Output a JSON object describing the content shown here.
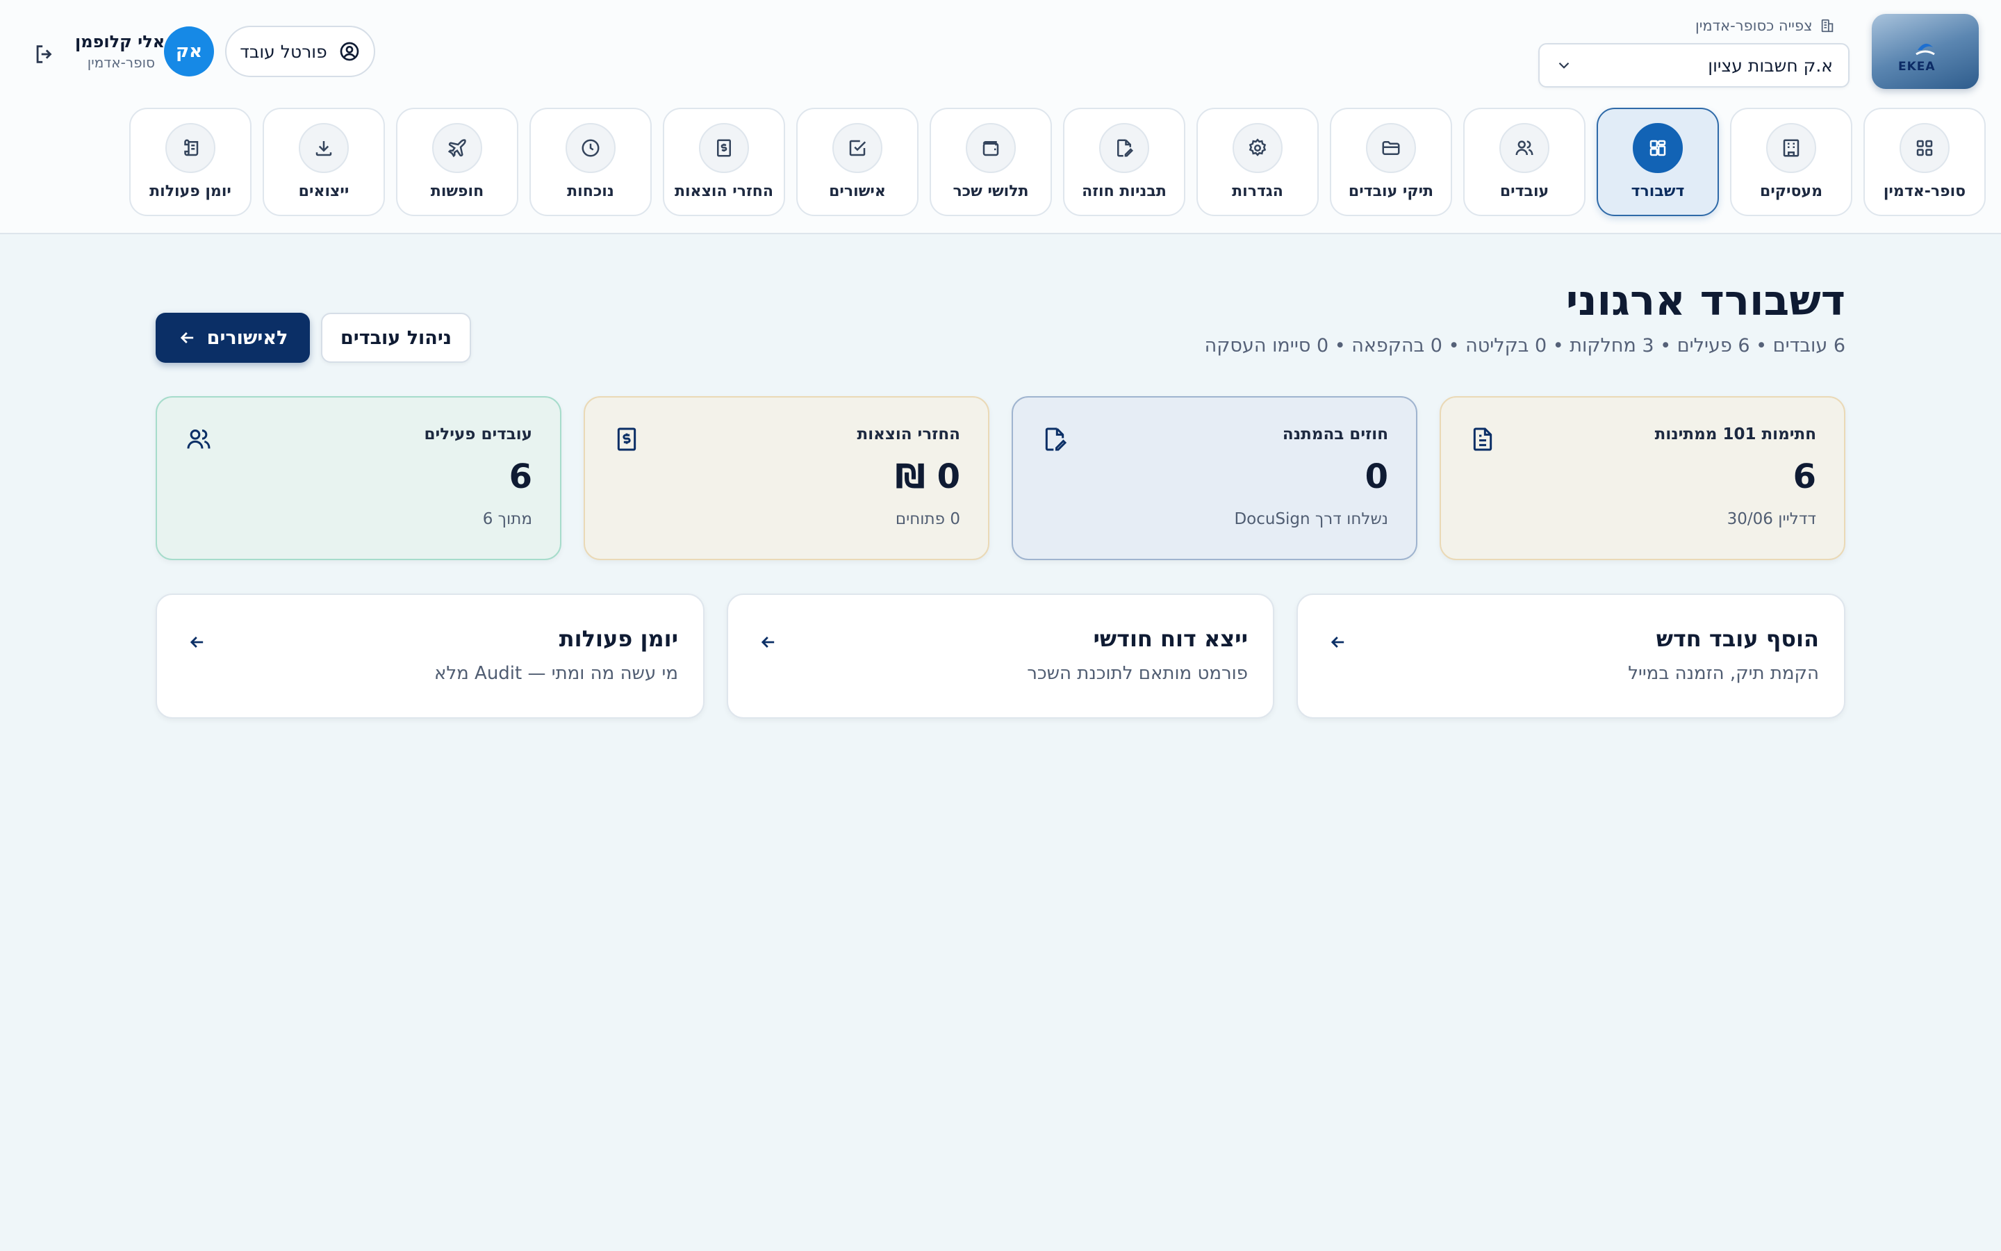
{
  "header": {
    "logo_text": "EKEA",
    "viewing_label": "צפייה כסופר-אדמין",
    "company_select": {
      "value": "א.ק חשבות עציון"
    },
    "user": {
      "name": "אלי קלופמן",
      "role": "סופר-אדמין",
      "initials": "אק"
    },
    "portal_button": "פורטל עובד"
  },
  "nav": {
    "tabs": [
      {
        "label": "סופר-אדמין",
        "icon": "grid-icon"
      },
      {
        "label": "מעסיקים",
        "icon": "building-icon"
      },
      {
        "label": "דשבורד",
        "icon": "dashboard-icon",
        "active": true
      },
      {
        "label": "עובדים",
        "icon": "users-icon"
      },
      {
        "label": "תיקי עובדים",
        "icon": "folder-icon"
      },
      {
        "label": "הגדרות",
        "icon": "gear-icon"
      },
      {
        "label": "תבניות חוזה",
        "icon": "file-edit-icon"
      },
      {
        "label": "תלושי שכר",
        "icon": "wallet-icon"
      },
      {
        "label": "אישורים",
        "icon": "check-square-icon"
      },
      {
        "label": "החזרי הוצאות",
        "icon": "receipt-icon"
      },
      {
        "label": "נוכחות",
        "icon": "clock-icon"
      },
      {
        "label": "חופשות",
        "icon": "plane-icon"
      },
      {
        "label": "ייצואים",
        "icon": "download-icon"
      },
      {
        "label": "יומן פעולות",
        "icon": "scroll-icon"
      }
    ]
  },
  "main": {
    "title": "דשבורד ארגוני",
    "summary": "6 עובדים • 6 פעילים • 3 מחלקות • 0 בקליטה • 0 בהקפאה • 0 סיימו העסקה",
    "buttons": {
      "primary": "לאישורים",
      "secondary": "ניהול עובדים"
    },
    "stats": [
      {
        "label": "חתימות 101 ממתינות",
        "value": "6",
        "sub": "דדליין 30/06",
        "icon": "document-icon"
      },
      {
        "label": "חוזים בהמתנה",
        "value": "0",
        "sub": "נשלחו דרך DocuSign",
        "icon": "file-signature-icon"
      },
      {
        "label": "החזרי הוצאות",
        "value": "0 ₪",
        "sub": "0 פתוחים",
        "icon": "receipt-icon"
      },
      {
        "label": "עובדים פעילים",
        "value": "6",
        "sub": "מתוך 6",
        "icon": "users-icon"
      }
    ],
    "actions": [
      {
        "title": "הוסף עובד חדש",
        "sub": "הקמת תיק, הזמנה במייל"
      },
      {
        "title": "ייצא דוח חודשי",
        "sub": "פורמט מותאם לתוכנת השכר"
      },
      {
        "title": "יומן פעולות",
        "sub": "מי עשה מה ומתי — Audit מלא"
      }
    ]
  },
  "colors": {
    "primary": "#0b2f66",
    "accent": "#1263b5",
    "avatar": "#1689e6",
    "background": "#eff6f9"
  }
}
